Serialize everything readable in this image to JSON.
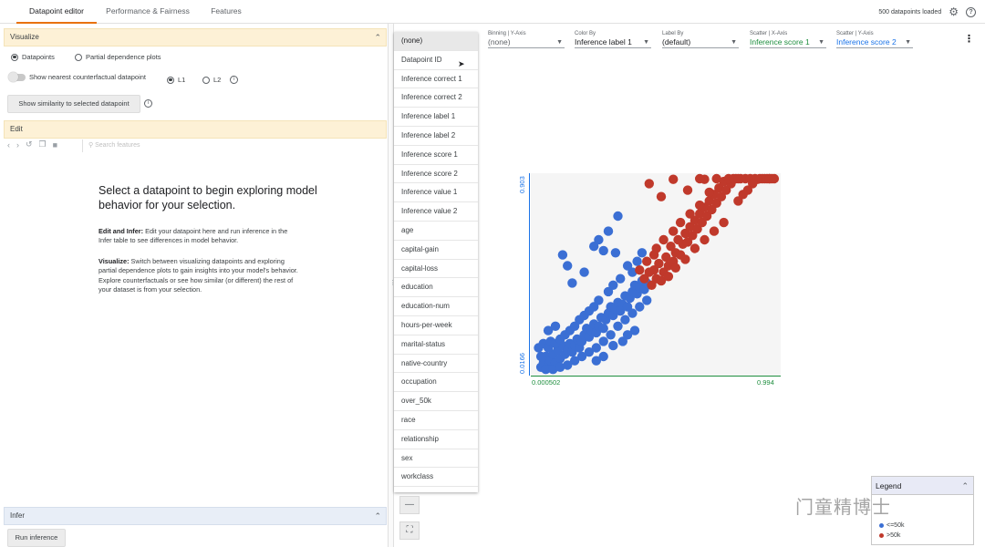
{
  "tabs": [
    "Datapoint editor",
    "Performance & Fairness",
    "Features"
  ],
  "status": "500 datapoints loaded",
  "visualize": {
    "header": "Visualize",
    "opt_datapoints": "Datapoints",
    "opt_pdp": "Partial dependence plots",
    "nearest_label": "Show nearest counterfactual datapoint",
    "l1": "L1",
    "l2": "L2",
    "similarity_button": "Show similarity to selected datapoint"
  },
  "edit": {
    "header": "Edit",
    "search_placeholder": "Search features"
  },
  "placeholder": {
    "title": "Select a datapoint to begin exploring model behavior for your selection.",
    "p1_bold": "Edit and Infer:",
    "p1_text": " Edit your datapoint here and run inference in the Infer table to see differences in model behavior.",
    "p2_bold": "Visualize:",
    "p2_text": " Switch between visualizing datapoints and exploring partial dependence plots to gain insights into your model's behavior. Explore counterfactuals or see how similar (or different) the rest of your dataset is from your selection."
  },
  "infer": {
    "header": "Infer",
    "run_button": "Run inference"
  },
  "dropdown_items": [
    "(none)",
    "Datapoint ID",
    "Inference correct 1",
    "Inference correct 2",
    "Inference label 1",
    "Inference label 2",
    "Inference score 1",
    "Inference score 2",
    "Inference value 1",
    "Inference value 2",
    "age",
    "capital-gain",
    "capital-loss",
    "education",
    "education-num",
    "hours-per-week",
    "marital-status",
    "native-country",
    "occupation",
    "over_50k",
    "race",
    "relationship",
    "sex",
    "workclass"
  ],
  "controls": {
    "binning_y": {
      "label": "Binning | Y-Axis",
      "value": "(none)"
    },
    "color_by": {
      "label": "Color By",
      "value": "Inference label 1"
    },
    "label_by": {
      "label": "Label By",
      "value": "(default)"
    },
    "scatter_x": {
      "label": "Scatter | X-Axis",
      "value": "Inference score 1"
    },
    "scatter_y": {
      "label": "Scatter | Y-Axis",
      "value": "Inference score 2"
    }
  },
  "chart_data": {
    "type": "scatter",
    "x_label": "Inference score 1",
    "y_label": "Inference score 2",
    "xlim": [
      0.000502,
      0.994
    ],
    "ylim": [
      0.0166,
      0.903
    ],
    "x_ticks": [
      "0.000502",
      "0.994"
    ],
    "y_ticks": [
      "0.0166",
      "0.903"
    ],
    "colors": {
      "le50k": "#3b6fd4",
      "gt50k": "#c0392b"
    },
    "series": [
      {
        "name": "<=50k",
        "color": "#3b6fd4",
        "points": [
          [
            0.02,
            0.03
          ],
          [
            0.03,
            0.05
          ],
          [
            0.05,
            0.04
          ],
          [
            0.04,
            0.08
          ],
          [
            0.06,
            0.06
          ],
          [
            0.08,
            0.05
          ],
          [
            0.07,
            0.09
          ],
          [
            0.1,
            0.07
          ],
          [
            0.09,
            0.11
          ],
          [
            0.12,
            0.09
          ],
          [
            0.11,
            0.13
          ],
          [
            0.13,
            0.11
          ],
          [
            0.15,
            0.1
          ],
          [
            0.14,
            0.14
          ],
          [
            0.16,
            0.13
          ],
          [
            0.18,
            0.12
          ],
          [
            0.17,
            0.16
          ],
          [
            0.19,
            0.15
          ],
          [
            0.2,
            0.18
          ],
          [
            0.22,
            0.17
          ],
          [
            0.21,
            0.21
          ],
          [
            0.23,
            0.2
          ],
          [
            0.25,
            0.19
          ],
          [
            0.24,
            0.23
          ],
          [
            0.26,
            0.22
          ],
          [
            0.28,
            0.21
          ],
          [
            0.27,
            0.26
          ],
          [
            0.29,
            0.25
          ],
          [
            0.3,
            0.28
          ],
          [
            0.32,
            0.27
          ],
          [
            0.31,
            0.31
          ],
          [
            0.33,
            0.3
          ],
          [
            0.35,
            0.29
          ],
          [
            0.34,
            0.33
          ],
          [
            0.36,
            0.32
          ],
          [
            0.38,
            0.31
          ],
          [
            0.37,
            0.36
          ],
          [
            0.39,
            0.35
          ],
          [
            0.4,
            0.38
          ],
          [
            0.42,
            0.37
          ],
          [
            0.41,
            0.41
          ],
          [
            0.43,
            0.4
          ],
          [
            0.45,
            0.39
          ],
          [
            0.44,
            0.43
          ],
          [
            0.46,
            0.42
          ],
          [
            0.02,
            0.08
          ],
          [
            0.01,
            0.12
          ],
          [
            0.03,
            0.14
          ],
          [
            0.05,
            0.12
          ],
          [
            0.06,
            0.15
          ],
          [
            0.08,
            0.14
          ],
          [
            0.1,
            0.16
          ],
          [
            0.12,
            0.18
          ],
          [
            0.14,
            0.2
          ],
          [
            0.16,
            0.22
          ],
          [
            0.18,
            0.25
          ],
          [
            0.2,
            0.27
          ],
          [
            0.22,
            0.29
          ],
          [
            0.24,
            0.31
          ],
          [
            0.26,
            0.34
          ],
          [
            0.04,
            0.02
          ],
          [
            0.07,
            0.02
          ],
          [
            0.1,
            0.03
          ],
          [
            0.13,
            0.04
          ],
          [
            0.16,
            0.06
          ],
          [
            0.19,
            0.08
          ],
          [
            0.22,
            0.1
          ],
          [
            0.25,
            0.12
          ],
          [
            0.28,
            0.15
          ],
          [
            0.31,
            0.18
          ],
          [
            0.34,
            0.22
          ],
          [
            0.37,
            0.25
          ],
          [
            0.4,
            0.28
          ],
          [
            0.43,
            0.31
          ],
          [
            0.46,
            0.34
          ],
          [
            0.15,
            0.42
          ],
          [
            0.13,
            0.5
          ],
          [
            0.11,
            0.55
          ],
          [
            0.2,
            0.47
          ],
          [
            0.24,
            0.59
          ],
          [
            0.26,
            0.62
          ],
          [
            0.28,
            0.57
          ],
          [
            0.34,
            0.73
          ],
          [
            0.3,
            0.66
          ],
          [
            0.4,
            0.47
          ],
          [
            0.42,
            0.52
          ],
          [
            0.44,
            0.56
          ],
          [
            0.35,
            0.44
          ],
          [
            0.38,
            0.5
          ],
          [
            0.33,
            0.56
          ],
          [
            0.41,
            0.2
          ],
          [
            0.38,
            0.18
          ],
          [
            0.36,
            0.15
          ],
          [
            0.32,
            0.13
          ],
          [
            0.28,
            0.08
          ],
          [
            0.25,
            0.06
          ],
          [
            0.05,
            0.2
          ],
          [
            0.08,
            0.22
          ],
          [
            0.3,
            0.38
          ],
          [
            0.32,
            0.41
          ]
        ]
      },
      {
        "name": ">50k",
        "color": "#c0392b",
        "points": [
          [
            0.48,
            0.41
          ],
          [
            0.5,
            0.44
          ],
          [
            0.52,
            0.43
          ],
          [
            0.49,
            0.48
          ],
          [
            0.53,
            0.47
          ],
          [
            0.55,
            0.5
          ],
          [
            0.54,
            0.54
          ],
          [
            0.57,
            0.52
          ],
          [
            0.58,
            0.56
          ],
          [
            0.6,
            0.55
          ],
          [
            0.56,
            0.59
          ],
          [
            0.61,
            0.6
          ],
          [
            0.59,
            0.62
          ],
          [
            0.63,
            0.61
          ],
          [
            0.62,
            0.65
          ],
          [
            0.65,
            0.64
          ],
          [
            0.64,
            0.68
          ],
          [
            0.67,
            0.67
          ],
          [
            0.66,
            0.71
          ],
          [
            0.69,
            0.7
          ],
          [
            0.68,
            0.74
          ],
          [
            0.71,
            0.73
          ],
          [
            0.7,
            0.77
          ],
          [
            0.73,
            0.76
          ],
          [
            0.72,
            0.8
          ],
          [
            0.75,
            0.79
          ],
          [
            0.74,
            0.83
          ],
          [
            0.77,
            0.82
          ],
          [
            0.76,
            0.86
          ],
          [
            0.79,
            0.85
          ],
          [
            0.78,
            0.89
          ],
          [
            0.81,
            0.88
          ],
          [
            0.8,
            0.92
          ],
          [
            0.83,
            0.91
          ],
          [
            0.82,
            0.95
          ],
          [
            0.85,
            0.94
          ],
          [
            0.84,
            0.97
          ],
          [
            0.87,
            0.96
          ],
          [
            0.89,
            0.97
          ],
          [
            0.91,
            0.98
          ],
          [
            0.93,
            0.99
          ],
          [
            0.95,
            1.0
          ],
          [
            0.97,
            0.98
          ],
          [
            0.96,
            0.95
          ],
          [
            0.94,
            0.93
          ],
          [
            0.92,
            0.9
          ],
          [
            0.9,
            0.88
          ],
          [
            0.88,
            0.85
          ],
          [
            0.86,
            0.83
          ],
          [
            0.84,
            0.8
          ],
          [
            0.45,
            0.44
          ],
          [
            0.47,
            0.47
          ],
          [
            0.51,
            0.51
          ],
          [
            0.55,
            0.45
          ],
          [
            0.58,
            0.49
          ],
          [
            0.62,
            0.53
          ],
          [
            0.66,
            0.58
          ],
          [
            0.7,
            0.62
          ],
          [
            0.74,
            0.66
          ],
          [
            0.78,
            0.7
          ],
          [
            0.5,
            0.58
          ],
          [
            0.53,
            0.62
          ],
          [
            0.57,
            0.66
          ],
          [
            0.6,
            0.7
          ],
          [
            0.64,
            0.74
          ],
          [
            0.68,
            0.78
          ],
          [
            0.72,
            0.84
          ],
          [
            0.43,
            0.48
          ],
          [
            0.46,
            0.52
          ],
          [
            0.49,
            0.55
          ],
          [
            0.7,
            0.9
          ],
          [
            0.75,
            0.93
          ],
          [
            0.47,
            0.88
          ],
          [
            0.57,
            0.9
          ],
          [
            0.68,
            0.96
          ],
          [
            0.52,
            0.82
          ],
          [
            0.63,
            0.85
          ],
          [
            0.99,
            0.99
          ],
          [
            0.97,
            0.96
          ],
          [
            0.98,
            0.92
          ]
        ]
      }
    ]
  },
  "legend": {
    "title": "Legend",
    "items": [
      "<=50k",
      ">50k"
    ]
  },
  "watermark": "门童精博士"
}
